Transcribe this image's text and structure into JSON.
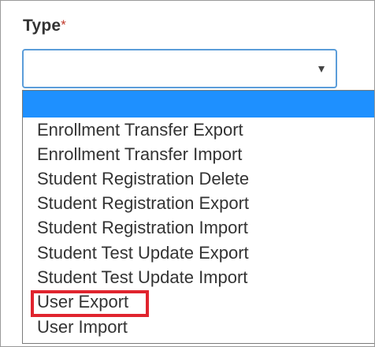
{
  "field": {
    "label": "Type",
    "required_mark": "*"
  },
  "select": {
    "value": "",
    "arrow_icon": "dropdown-arrow-icon"
  },
  "dropdown": {
    "selected_index": 0,
    "options": [
      "",
      "Enrollment Transfer Export",
      "Enrollment Transfer Import",
      "Student Registration Delete",
      "Student Registration Export",
      "Student Registration Import",
      "Student Test Update Export",
      "Student Test Update Import",
      "User Export",
      "User Import"
    ]
  },
  "highlight": {
    "target": "User Export",
    "color": "#e0242e"
  },
  "colors": {
    "accent": "#1e90ff",
    "select_border": "#5b9dd9",
    "required": "#c0392b"
  }
}
